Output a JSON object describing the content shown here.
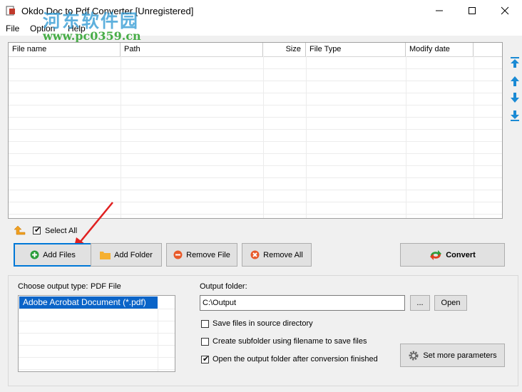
{
  "window": {
    "title": "Okdo Doc to Pdf Converter [Unregistered]"
  },
  "watermark": {
    "line1": "河东软件园",
    "line2": "www.pc0359.cn"
  },
  "menu": [
    "File",
    "Option",
    "Help"
  ],
  "file_list": {
    "columns": [
      "File name",
      "Path",
      "Size",
      "File Type",
      "Modify date"
    ],
    "rows": []
  },
  "select_all": {
    "label": "Select All",
    "checked": true
  },
  "buttons": {
    "add_files": "Add Files",
    "add_folder": "Add Folder",
    "remove_file": "Remove File",
    "remove_all": "Remove All",
    "convert": "Convert",
    "browse": "...",
    "open": "Open",
    "set_more": "Set more parameters"
  },
  "output_type": {
    "label": "Choose output type:",
    "value": "PDF File",
    "options": [
      "Adobe Acrobat Document (*.pdf)"
    ]
  },
  "output_folder": {
    "label": "Output folder:",
    "value": "C:\\Output"
  },
  "options": {
    "save_in_source": {
      "label": "Save files in source directory",
      "checked": false
    },
    "create_subfolder": {
      "label": "Create subfolder using filename to save files",
      "checked": false
    },
    "open_after": {
      "label": "Open the output folder after conversion finished",
      "checked": true
    }
  },
  "colors": {
    "accent_blue": "#1a8ad4",
    "selection": "#0a64c8",
    "annotation_arrow": "#e02020"
  }
}
